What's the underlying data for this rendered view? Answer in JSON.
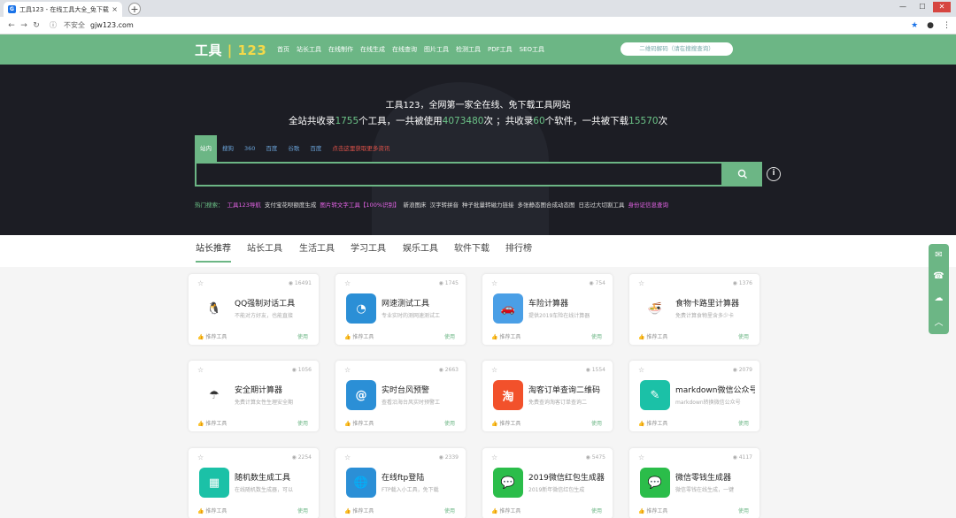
{
  "browser": {
    "tab_title": "工具123 - 在线工具大全_免下载",
    "tab_close": "×",
    "new_tab": "+",
    "security": "不安全",
    "url": "gjw123.com"
  },
  "site": {
    "logo_text": "工具",
    "logo_sep": "|",
    "logo_num": "123",
    "nav": [
      "首页",
      "站长工具",
      "在线制作",
      "在线生成",
      "在线查询",
      "图片工具",
      "检测工具",
      "PDF工具",
      "SEO工具"
    ],
    "qr_button": "二维码解码（请在搜搜查询）"
  },
  "hero": {
    "headline": "工具123，全网第一家全在线、免下载工具网站",
    "stats_prefix": "全站共收录",
    "tools_count": "1755",
    "stats_mid1": "个工具，一共被使用",
    "use_count": "4073480",
    "stats_mid2": "次 ；共收录",
    "soft_count": "60",
    "stats_mid3": "个软件，一共被下载",
    "download_count": "15570",
    "stats_suffix": "次"
  },
  "search": {
    "tabs": [
      "站内",
      "搜狗",
      "360",
      "百度",
      "谷歌",
      "百度"
    ],
    "promo": "点击这里获取更多资讯",
    "hot_label": "热门搜索：",
    "hot": [
      {
        "t": "工具123导航",
        "c": "mg"
      },
      {
        "t": "支付宝花呗额度生成",
        "c": ""
      },
      {
        "t": "图片转文字工具【100%识别】",
        "c": "mg"
      },
      {
        "t": "新浪图床",
        "c": ""
      },
      {
        "t": "汉字转拼音",
        "c": ""
      },
      {
        "t": "种子批量转磁力链接",
        "c": ""
      },
      {
        "t": "多张静态图合成动态图",
        "c": ""
      },
      {
        "t": "日志过大切割工具",
        "c": ""
      },
      {
        "t": "身份证信息查询",
        "c": "mg"
      }
    ]
  },
  "categories": [
    "站长推荐",
    "站长工具",
    "生活工具",
    "学习工具",
    "娱乐工具",
    "软件下载",
    "排行榜"
  ],
  "cards": [
    {
      "name": "QQ强制对话工具",
      "desc": "不能对方好友，也能直接",
      "views": "16491",
      "icon": "qq-penguin-icon",
      "color": "#ffffff",
      "glyph": "🐧"
    },
    {
      "name": "网速测试工具",
      "desc": "专业实时的测网速测试工",
      "views": "1745",
      "icon": "speedometer-icon",
      "color": "#2b8fd6",
      "glyph": "◔"
    },
    {
      "name": "车险计算器",
      "desc": "提供2019车险在线计算器",
      "views": "754",
      "icon": "car-icon",
      "color": "#4a9fe6",
      "glyph": "🚗"
    },
    {
      "name": "食物卡路里计算器",
      "desc": "免费计算食物里含多少卡",
      "views": "1376",
      "icon": "food-bowl-icon",
      "color": "#ffffff",
      "glyph": "🍜"
    },
    {
      "name": "安全期计算器",
      "desc": "免费计算女性生理安全期",
      "views": "1056",
      "icon": "umbrella-icon",
      "color": "#ffffff",
      "glyph": "☂"
    },
    {
      "name": "实时台风预警",
      "desc": "查看沿海台风实时预警工",
      "views": "2663",
      "icon": "typhoon-icon",
      "color": "#2b8fd6",
      "glyph": "@"
    },
    {
      "name": "淘客订单查询二维码",
      "desc": "免费查询淘客订单查询二",
      "views": "1554",
      "icon": "taobao-icon",
      "color": "#f2512b",
      "glyph": "淘"
    },
    {
      "name": "markdown微信公众号",
      "desc": "markdown转换微信公众号",
      "views": "2079",
      "icon": "markdown-edit-icon",
      "color": "#1bc1a7",
      "glyph": "✎"
    },
    {
      "name": "随机数生成工具",
      "desc": "在线随机数生成器，可以",
      "views": "2254",
      "icon": "grid-blocks-icon",
      "color": "#1bc1a7",
      "glyph": "▦"
    },
    {
      "name": "在线ftp登陆",
      "desc": "FTP载入小工具，免下载",
      "views": "2339",
      "icon": "globe-icon",
      "color": "#2b8fd6",
      "glyph": "🌐"
    },
    {
      "name": "2019微信红包生成器",
      "desc": "2019新年微信红包生成",
      "views": "5475",
      "icon": "wechat-icon",
      "color": "#2bbd4a",
      "glyph": "💬"
    },
    {
      "name": "微信零钱生成器",
      "desc": "微信零钱在线生成，一键",
      "views": "4117",
      "icon": "wechat-wallet-icon",
      "color": "#2bbd4a",
      "glyph": "💬"
    }
  ],
  "card_labels": {
    "recommend": "推荐工具",
    "use": "使用"
  },
  "colors": {
    "brand": "#6cb685",
    "hero_bg": "#1c1d24",
    "accent_green": "#6cc488",
    "magenta": "#e463e6"
  }
}
